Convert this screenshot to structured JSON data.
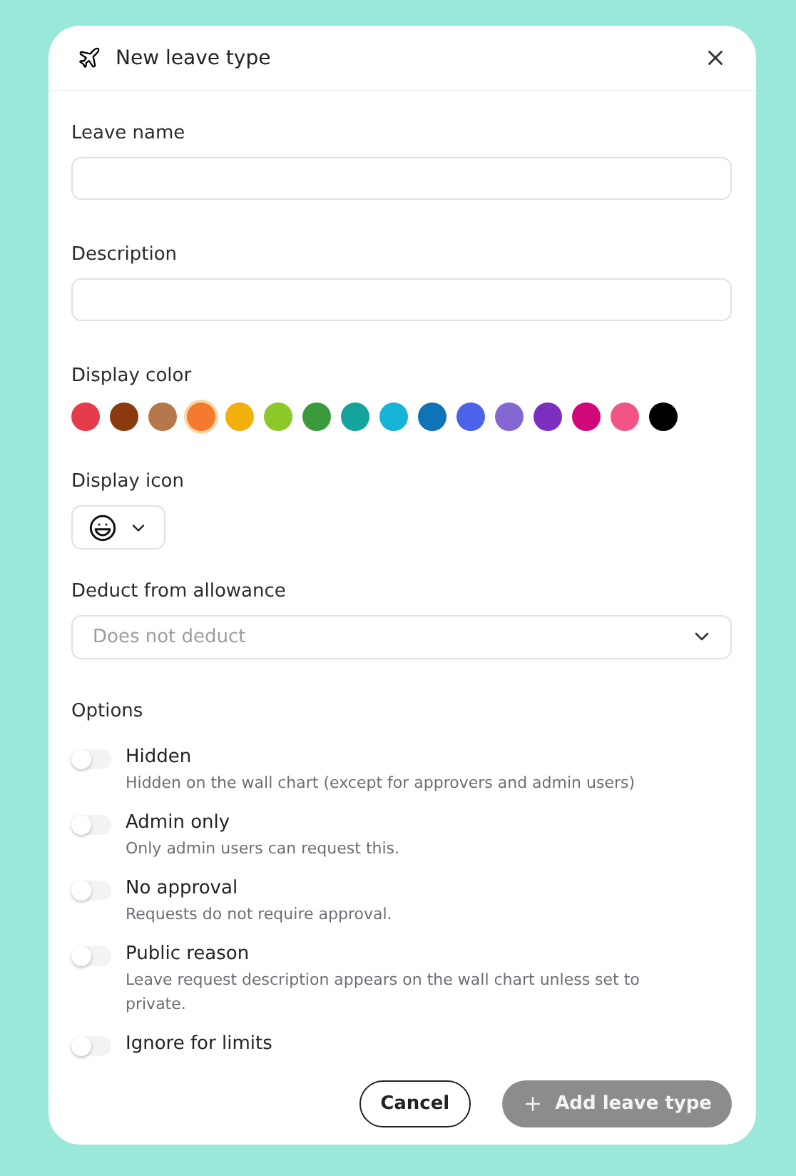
{
  "dialog": {
    "title": "New leave type"
  },
  "fields": [
    {
      "label": "Leave name"
    },
    {
      "label": "Description"
    }
  ],
  "display_color": {
    "label": "Display color",
    "colors": [
      {
        "color": "#e43c4a",
        "selected": false
      },
      {
        "color": "#8b3a0f",
        "selected": false
      },
      {
        "color": "#b5784a",
        "selected": false
      },
      {
        "color": "#f57a30",
        "selected": true
      },
      {
        "color": "#f2b00c",
        "selected": false
      },
      {
        "color": "#8cc82a",
        "selected": false
      },
      {
        "color": "#3a9a3c",
        "selected": false
      },
      {
        "color": "#14a39d",
        "selected": false
      },
      {
        "color": "#16b4d9",
        "selected": false
      },
      {
        "color": "#0e74b5",
        "selected": false
      },
      {
        "color": "#4a63e8",
        "selected": false
      },
      {
        "color": "#8567d4",
        "selected": false
      },
      {
        "color": "#7a2fbf",
        "selected": false
      },
      {
        "color": "#d1087a",
        "selected": false
      },
      {
        "color": "#f25585",
        "selected": false
      },
      {
        "color": "#000000",
        "selected": false
      }
    ]
  },
  "display_icon": {
    "label": "Display icon"
  },
  "deduct": {
    "label": "Deduct from allowance",
    "placeholder": "Does not deduct"
  },
  "options": {
    "label": "Options",
    "items": [
      {
        "title": "Hidden",
        "description": "Hidden on the wall chart (except for approvers and admin users)",
        "on": false
      },
      {
        "title": "Admin only",
        "description": "Only admin users can request this.",
        "on": false
      },
      {
        "title": "No approval",
        "description": "Requests do not require approval.",
        "on": false
      },
      {
        "title": "Public reason",
        "description": "Leave request description appears on the wall chart unless set to private.",
        "on": false
      },
      {
        "title": "Ignore for limits",
        "on": false
      }
    ]
  },
  "buttons": {
    "cancel": "Cancel",
    "submit": "Add leave type"
  }
}
